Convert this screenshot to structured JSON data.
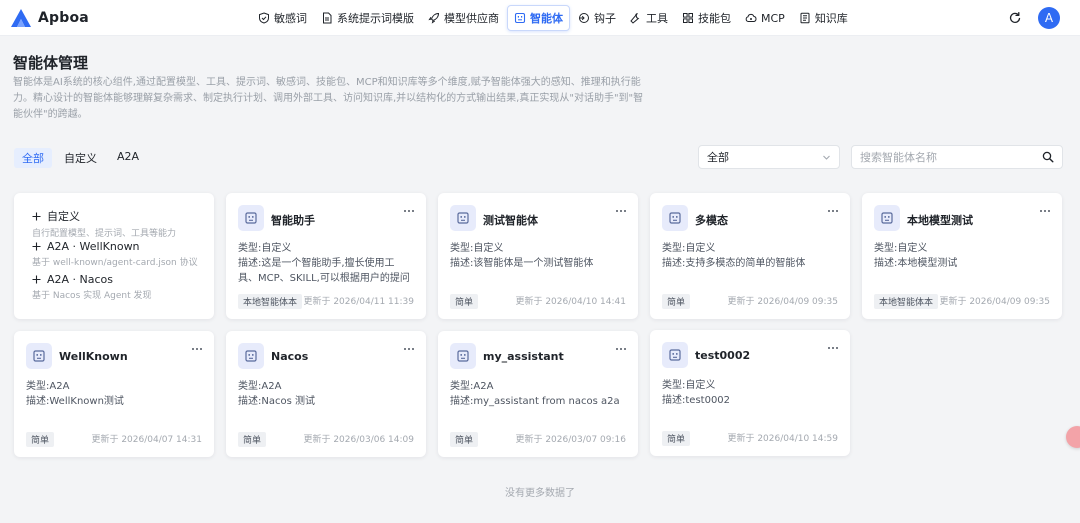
{
  "app": {
    "name": "Apboa",
    "avatar_letter": "A",
    "accent": "#2f6bf3"
  },
  "nav": [
    {
      "label": "敏感词",
      "icon": "shield-icon"
    },
    {
      "label": "系统提示词模版",
      "icon": "document-icon"
    },
    {
      "label": "模型供应商",
      "icon": "rocket-icon"
    },
    {
      "label": "智能体",
      "icon": "agent-icon",
      "active": true
    },
    {
      "label": "钩子",
      "icon": "hook-icon"
    },
    {
      "label": "工具",
      "icon": "wrench-icon"
    },
    {
      "label": "技能包",
      "icon": "grid-icon"
    },
    {
      "label": "MCP",
      "icon": "cloud-icon"
    },
    {
      "label": "知识库",
      "icon": "book-icon"
    }
  ],
  "page": {
    "title": "智能体管理",
    "description": "智能体是AI系统的核心组件,通过配置模型、工具、提示词、敏感词、技能包、MCP和知识库等多个维度,赋予智能体强大的感知、推理和执行能力。精心设计的智能体能够理解复杂需求、制定执行计划、调用外部工具、访问知识库,并以结构化的方式输出结果,真正实现从\"对话助手\"到\"智能伙伴\"的跨越。"
  },
  "filters": {
    "tabs": [
      "全部",
      "自定义",
      "A2A"
    ],
    "active_tab": 0,
    "select_value": "全部",
    "search_placeholder": "搜索智能体名称"
  },
  "create_card": [
    {
      "title": "自定义",
      "subtitle": "自行配置模型、提示词、工具等能力"
    },
    {
      "title": "A2A · WellKnown",
      "subtitle": "基于 well-known/agent-card.json 协议"
    },
    {
      "title": "A2A · Nacos",
      "subtitle": "基于 Nacos 实现 Agent 发现"
    }
  ],
  "labels": {
    "type_prefix": "类型:",
    "desc_prefix": "描述:",
    "updated_prefix": "更新于 "
  },
  "agents": [
    {
      "name": "智能助手",
      "type": "自定义",
      "desc": "这是一个智能助手,擅长使用工具、MCP、SKILL,可以根据用户的提问精准...",
      "badge": "本地智能体本",
      "updated": "2026/04/11 11:39"
    },
    {
      "name": "测试智能体",
      "type": "自定义",
      "desc": "该智能体是一个测试智能体",
      "badge": "简单",
      "updated": "2026/04/10 14:41"
    },
    {
      "name": "多模态",
      "type": "自定义",
      "desc": "支持多模态的简单的智能体",
      "badge": "简单",
      "updated": "2026/04/09 09:35"
    },
    {
      "name": "本地模型测试",
      "type": "自定义",
      "desc": "本地模型测试",
      "badge": "本地智能体本",
      "updated": "2026/04/09 09:35"
    },
    {
      "name": "WellKnown",
      "type": "A2A",
      "desc": "WellKnown测试",
      "badge": "简单",
      "updated": "2026/04/07 14:31"
    },
    {
      "name": "Nacos",
      "type": "A2A",
      "desc": "Nacos 测试",
      "badge": "简单",
      "updated": "2026/03/06 14:09"
    },
    {
      "name": "my_assistant",
      "type": "A2A",
      "desc": "my_assistant from nacos a2a",
      "badge": "简单",
      "updated": "2026/03/07 09:16"
    },
    {
      "name": "test0002",
      "type": "自定义",
      "desc": "test0002",
      "badge": "简单",
      "updated": "2026/04/10 14:59"
    }
  ],
  "footer": "没有更多数据了"
}
